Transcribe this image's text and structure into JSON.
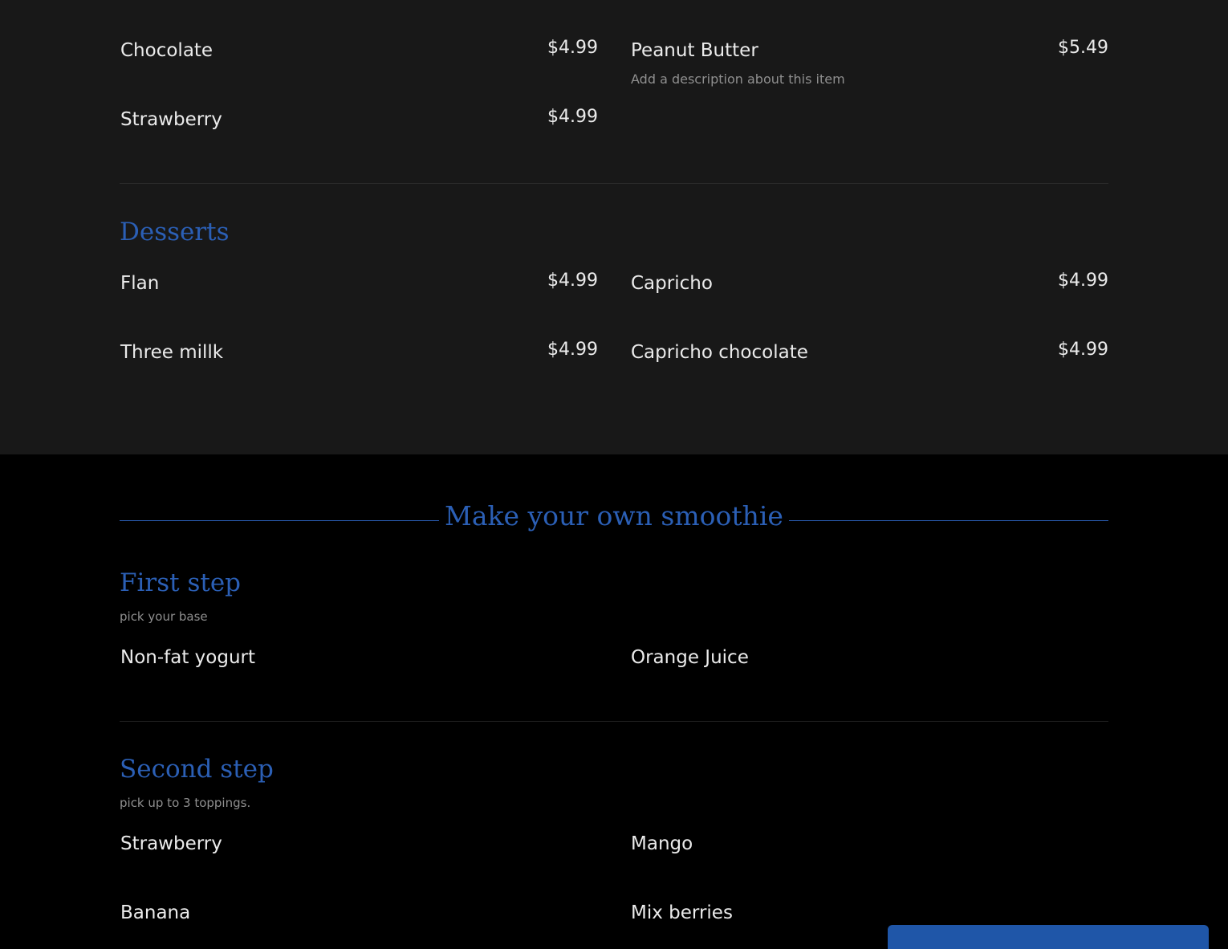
{
  "drinks_continued": {
    "items": [
      {
        "name": "Chocolate",
        "price": "$4.99"
      },
      {
        "name": "Peanut Butter",
        "price": "$5.49",
        "description": "Add a description about this item"
      },
      {
        "name": "Strawberry",
        "price": "$4.99"
      }
    ]
  },
  "desserts": {
    "heading": "Desserts",
    "items": [
      {
        "name": "Flan",
        "price": "$4.99"
      },
      {
        "name": "Capricho",
        "price": "$4.99"
      },
      {
        "name": "Three millk",
        "price": "$4.99"
      },
      {
        "name": "Capricho chocolate",
        "price": "$4.99"
      }
    ]
  },
  "smoothie": {
    "title": "Make your own smoothie",
    "first_step": {
      "heading": "First step",
      "subtitle": "pick your base",
      "items": [
        "Non-fat yogurt",
        "Orange Juice"
      ]
    },
    "second_step": {
      "heading": "Second step",
      "subtitle": "pick up to 3 toppings.",
      "items": [
        "Strawberry",
        "Mango",
        "Banana",
        "Mix berries"
      ]
    }
  },
  "colors": {
    "accent": "#2b5fb5",
    "upper_bg": "#181818",
    "lower_bg": "#000000",
    "text": "#ebebeb",
    "muted": "#8f8f8f"
  }
}
